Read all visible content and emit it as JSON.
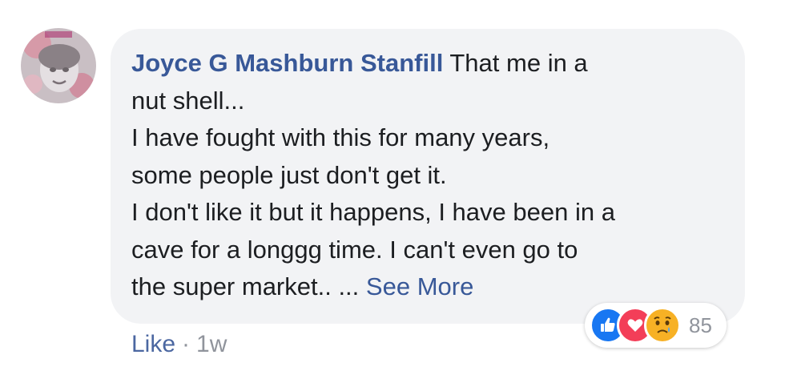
{
  "comment": {
    "author": "Joyce G Mashburn Stanfill",
    "text_lines": [
      "That me in a",
      "nut shell...",
      "I have fought with this for many years,",
      "some people just don't get it.",
      "I don't like it but it happens, I have been in a",
      "cave for a longgg time. I can't even go to",
      "the super market.. ..."
    ],
    "see_more": "See More"
  },
  "reactions": {
    "icons": [
      "like-icon",
      "love-icon",
      "sad-icon"
    ],
    "count": "85",
    "colors": {
      "like": "#1877f2",
      "love": "#f33e58",
      "sad": "#f7b125"
    }
  },
  "actions": {
    "like": "Like",
    "separator": "·",
    "time": "1w"
  },
  "colors": {
    "link": "#385898",
    "bubble": "#f2f3f5",
    "text": "#1c1e21",
    "meta": "#90949c"
  }
}
